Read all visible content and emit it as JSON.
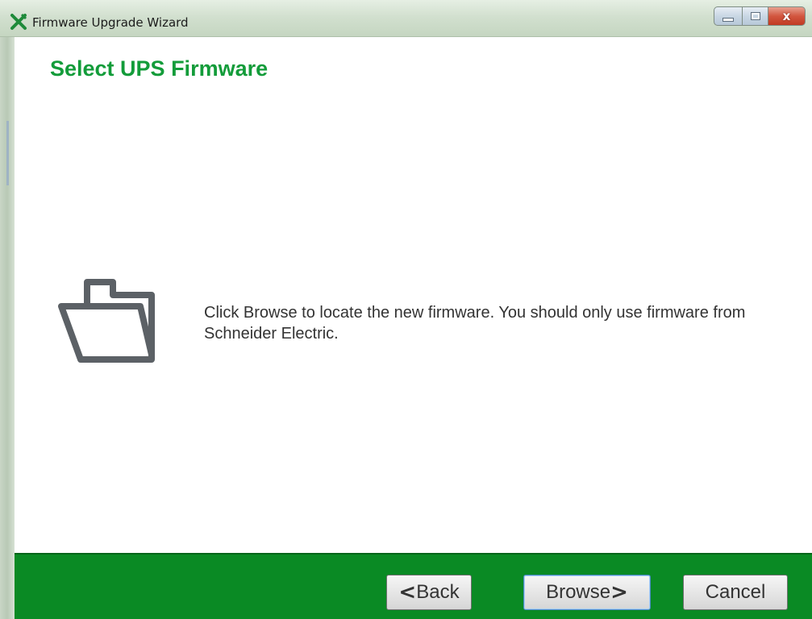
{
  "window": {
    "title": "Firmware Upgrade Wizard",
    "controls": {
      "minimize_icon": "minimize-icon",
      "maximize_icon": "maximize-icon",
      "close_glyph": "x"
    }
  },
  "page": {
    "title": "Select UPS Firmware",
    "icon": "folder-icon",
    "message": "Click Browse to locate the new firmware. You should only use firmware from Schneider Electric."
  },
  "buttons": {
    "back_arrow": "<",
    "back_label": "Back",
    "browse_label": "Browse",
    "browse_arrow": ">",
    "cancel_label": "Cancel"
  },
  "colors": {
    "accent_green": "#139c3a",
    "footer_green": "#0a8a24",
    "close_red": "#c13a23"
  }
}
